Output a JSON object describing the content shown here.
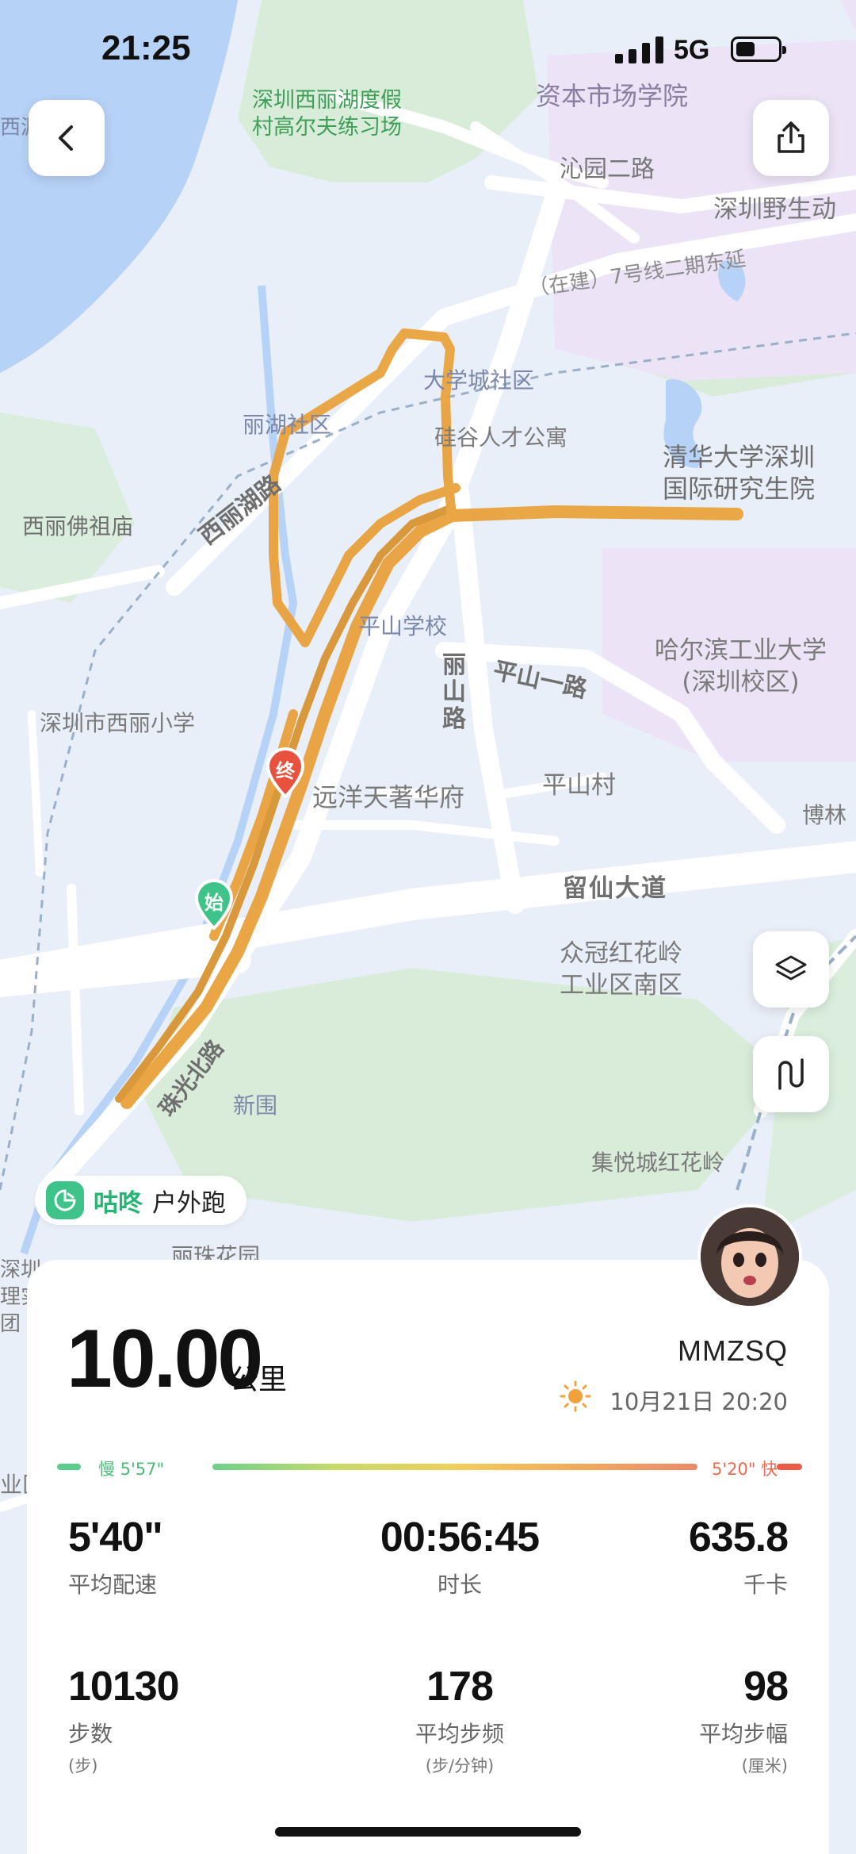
{
  "status_bar": {
    "time": "21:25",
    "network": "5G",
    "battery_level": 0.45
  },
  "map": {
    "labels": {
      "golf": "深圳西丽湖度假\n村高尔夫练习场",
      "capital_school": "资本市场学院",
      "qinyuan_road2": "沁园二路",
      "wild_zoo": "深圳野生动",
      "metro_line7": "（在建）7号线二期东延",
      "univ_city": "大学城社区",
      "lihu_community": "丽湖社区",
      "silicon_valley": "硅谷人才公寓",
      "tsinghua": "清华大学深圳\n国际研究生院",
      "xili_lake_road": "西丽湖路",
      "xili_temple": "西丽佛祖庙",
      "pingshan_school": "平山学校",
      "hit": "哈尔滨工业大学\n(深圳校区)",
      "lishan_road": "丽山路",
      "pingshan_road1": "平山一路",
      "xili_primary": "深圳市西丽小学",
      "yuanyang": "远洋天著华府",
      "pingshan_village": "平山村",
      "bolin": "博林",
      "liuxian_avenue": "留仙大道",
      "zhongguan": "众冠红花岭\n工业区南区",
      "zhuguang_north": "珠光北路",
      "xinwei": "新围",
      "jiyue": "集悦城红花岭",
      "lizhu": "丽珠花园",
      "left_edge_top": "西沥",
      "left_edge_mid": "深圳\n理实\n团",
      "left_edge_low": "业区"
    },
    "start_marker": "始",
    "end_marker": "终"
  },
  "brand": {
    "name": "咕咚",
    "activity": "户外跑"
  },
  "summary": {
    "distance": "10.00",
    "distance_unit": "公里",
    "username": "MMZSQ",
    "date": "10月21日 20:20",
    "pace_legend": {
      "slow": "慢 5'57\"",
      "fast": "5'20\" 快"
    }
  },
  "stats": [
    {
      "value": "5'40\"",
      "label": "平均配速",
      "unit": ""
    },
    {
      "value": "00:56:45",
      "label": "时长",
      "unit": ""
    },
    {
      "value": "635.8",
      "label": "千卡",
      "unit": ""
    },
    {
      "value": "10130",
      "label": "步数",
      "unit": "(步)"
    },
    {
      "value": "178",
      "label": "平均步频",
      "unit": "(步/分钟)"
    },
    {
      "value": "98",
      "label": "平均步幅",
      "unit": "(厘米)"
    }
  ],
  "colors": {
    "route": "#e9a23c",
    "water": "#b7d2f7",
    "green": "#d6ecd9",
    "campus": "#ece3f6",
    "brand": "#27b574"
  }
}
